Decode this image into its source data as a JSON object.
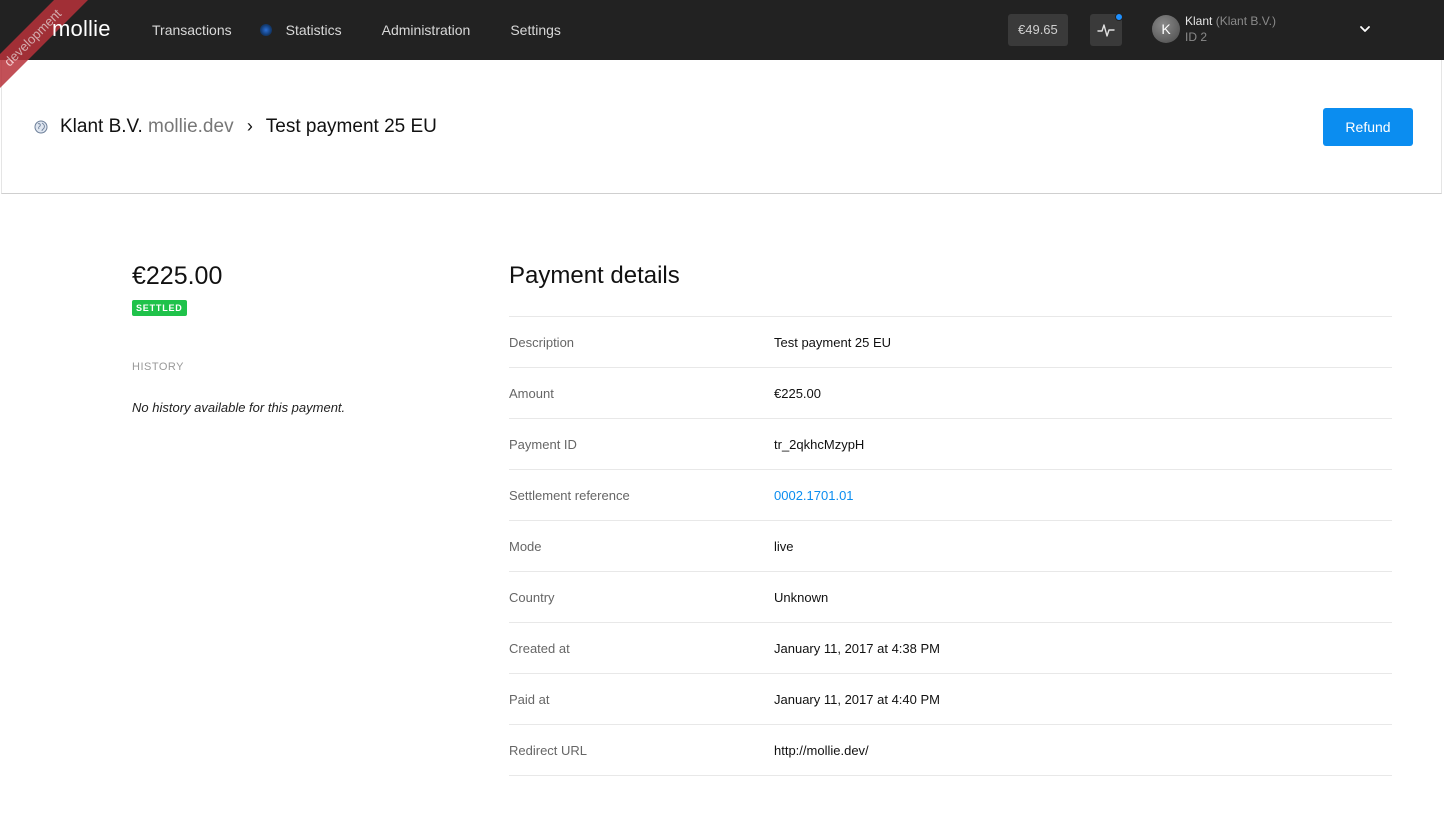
{
  "app": {
    "logo": "mollie",
    "environment_ribbon": "development"
  },
  "nav": {
    "items": [
      {
        "label": "Transactions"
      },
      {
        "label": "Statistics"
      },
      {
        "label": "Administration"
      },
      {
        "label": "Settings"
      }
    ]
  },
  "account": {
    "balance": "€49.65",
    "avatar_initial": "K",
    "user_name": "Klant",
    "org_name": "(Klant B.V.)",
    "user_id": "ID 2"
  },
  "header": {
    "org": "Klant B.V.",
    "domain": "mollie.dev",
    "separator": "›",
    "page": "Test payment 25 EU",
    "refund_label": "Refund"
  },
  "summary": {
    "amount": "€225.00",
    "status": "SETTLED",
    "history_title": "HISTORY",
    "history_empty": "No history available for this payment."
  },
  "details": {
    "title": "Payment details",
    "rows": [
      {
        "label": "Description",
        "value": "Test payment 25 EU"
      },
      {
        "label": "Amount",
        "value": "€225.00"
      },
      {
        "label": "Payment ID",
        "value": "tr_2qkhcMzypH"
      },
      {
        "label": "Settlement reference",
        "value": "0002.1701.01"
      },
      {
        "label": "Mode",
        "value": "live"
      },
      {
        "label": "Country",
        "value": "Unknown"
      },
      {
        "label": "Created at",
        "value": "January 11, 2017 at 4:38 PM"
      },
      {
        "label": "Paid at",
        "value": "January 11, 2017 at 4:40 PM"
      },
      {
        "label": "Redirect URL",
        "value": "http://mollie.dev/"
      }
    ]
  },
  "colors": {
    "topbar": "#222222",
    "accent": "#0b8df0",
    "settled": "#1fc24a",
    "ribbon": "#b8323a"
  }
}
